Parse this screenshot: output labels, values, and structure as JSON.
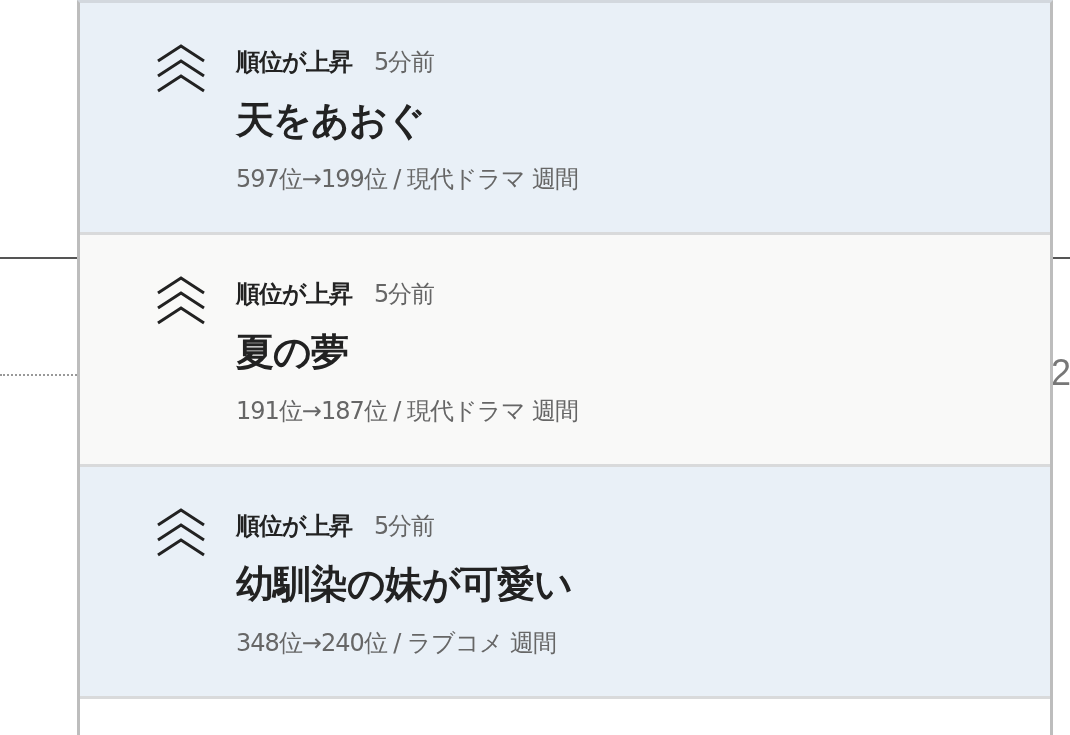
{
  "background": {
    "fragment": "2"
  },
  "notifications": [
    {
      "unread": true,
      "event": "順位が上昇",
      "time": "5分前",
      "title": "天をあおぐ",
      "detail": "597位→199位 / 現代ドラマ 週間"
    },
    {
      "unread": false,
      "event": "順位が上昇",
      "time": "5分前",
      "title": "夏の夢",
      "detail": "191位→187位 / 現代ドラマ 週間"
    },
    {
      "unread": true,
      "event": "順位が上昇",
      "time": "5分前",
      "title": "幼馴染の妹が可愛い",
      "detail": "348位→240位 / ラブコメ 週間"
    }
  ]
}
